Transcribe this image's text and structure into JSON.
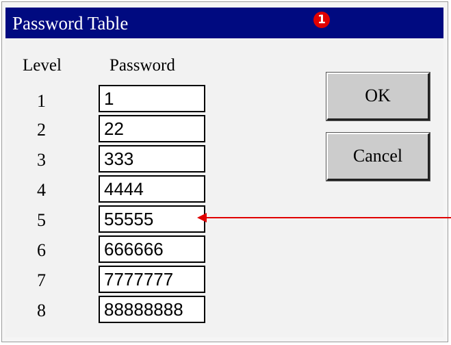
{
  "window": {
    "title": "Password Table",
    "callout": "1"
  },
  "table": {
    "level_header": "Level",
    "password_header": "Password",
    "rows": [
      {
        "level": "1",
        "password": "1"
      },
      {
        "level": "2",
        "password": "22"
      },
      {
        "level": "3",
        "password": "333"
      },
      {
        "level": "4",
        "password": "4444"
      },
      {
        "level": "5",
        "password": "55555"
      },
      {
        "level": "6",
        "password": "666666"
      },
      {
        "level": "7",
        "password": "7777777"
      },
      {
        "level": "8",
        "password": "88888888"
      }
    ]
  },
  "buttons": {
    "ok_label": "OK",
    "cancel_label": "Cancel"
  },
  "colors": {
    "titlebar": "#000a80",
    "callout": "#e00000",
    "arrow": "#e00000"
  }
}
